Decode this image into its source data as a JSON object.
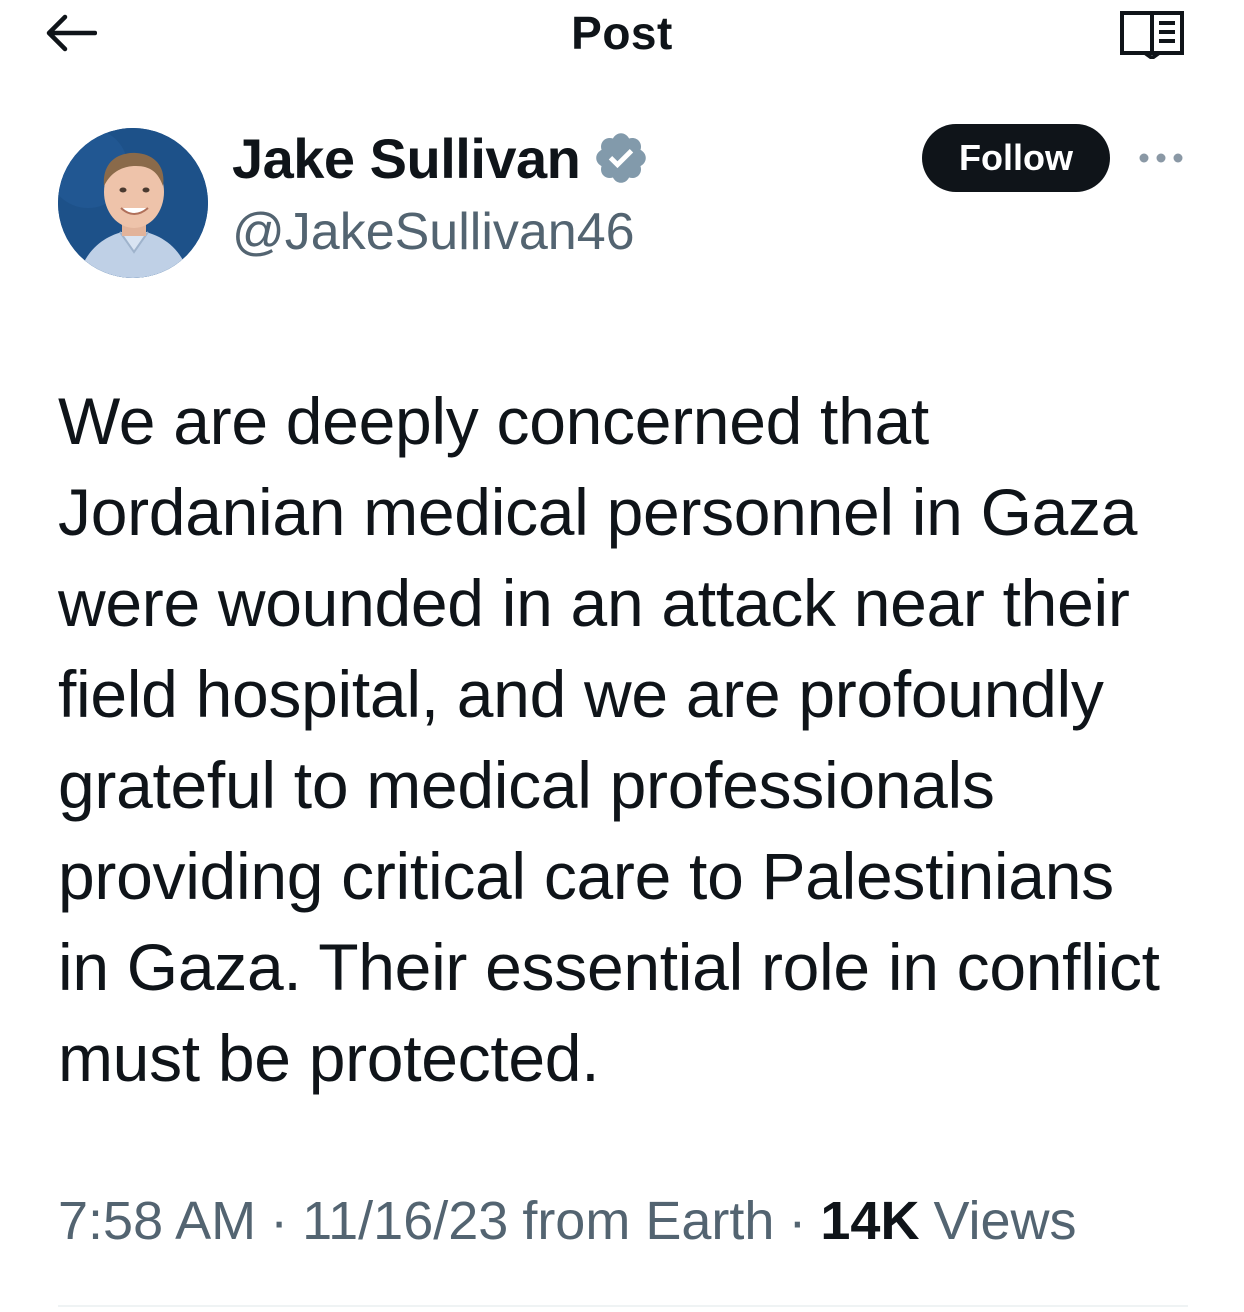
{
  "header": {
    "title": "Post",
    "back_icon": "arrow-left-icon",
    "reader_icon": "open-book-icon"
  },
  "author": {
    "name": "Jake Sullivan",
    "handle": "@JakeSullivan46",
    "verified_icon": "verified-badge-icon",
    "verified_color": "#829aab"
  },
  "actions": {
    "follow_label": "Follow",
    "more_icon": "more-dots-icon"
  },
  "post": {
    "lines": [
      "We are deeply concerned that",
      "Jordanian medical personnel in Gaza",
      "were wounded in an attack near their",
      "field hospital, and we are profoundly",
      "grateful to medical professionals",
      "providing critical care to Palestinians",
      "in Gaza. Their essential role in conflict",
      "must be protected."
    ]
  },
  "meta": {
    "time": "7:58 AM",
    "date": "11/16/23",
    "source": "from Earth",
    "separator": "·",
    "views_count": "14K",
    "views_label": "Views"
  },
  "colors": {
    "text_primary": "#0f1419",
    "text_secondary": "#536471",
    "follow_bg": "#0f1419"
  }
}
